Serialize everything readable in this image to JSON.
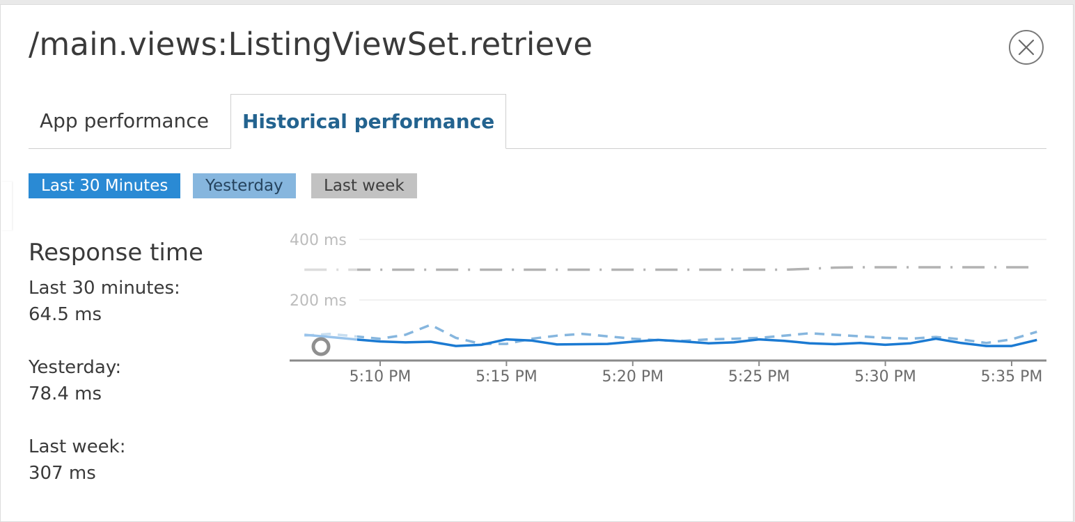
{
  "header": {
    "title": "/main.views:ListingViewSet.retrieve",
    "close_icon": "close-icon"
  },
  "tabs": [
    {
      "label": "App performance",
      "active": false
    },
    {
      "label": "Historical performance",
      "active": true
    }
  ],
  "range_buttons": [
    {
      "label": "Last 30 Minutes",
      "color": "#2a8ad4"
    },
    {
      "label": "Yesterday",
      "color": "#86b6de"
    },
    {
      "label": "Last week",
      "color": "#c2c2c2"
    }
  ],
  "summary": {
    "title": "Response time",
    "last30_label": "Last 30 minutes:",
    "last30_value": "64.5 ms",
    "yesterday_label": "Yesterday:",
    "yesterday_value": "78.4 ms",
    "lastweek_label": "Last week:",
    "lastweek_value": "307 ms"
  },
  "chart_data": {
    "type": "line",
    "title": "",
    "xlabel": "",
    "ylabel": "",
    "ylim": [
      0,
      400
    ],
    "y_ticks": [
      {
        "value": 200,
        "label": "200 ms"
      },
      {
        "value": 400,
        "label": "400 ms"
      }
    ],
    "x_ticks": [
      "5:10 PM",
      "5:15 PM",
      "5:20 PM",
      "5:25 PM",
      "5:30 PM",
      "5:35 PM"
    ],
    "x_tick_minutes": [
      10,
      15,
      20,
      25,
      30,
      35
    ],
    "x_range_minutes": [
      7,
      36
    ],
    "grid": true,
    "series": [
      {
        "key": "last_30_minutes",
        "color": "#1b7ad2",
        "style": "solid",
        "x": [
          7,
          8,
          9,
          10,
          11,
          12,
          13,
          14,
          15,
          16,
          17,
          18,
          19,
          20,
          21,
          22,
          23,
          24,
          25,
          26,
          27,
          28,
          29,
          30,
          31,
          32,
          33,
          34,
          35,
          36
        ],
        "values": [
          85,
          78,
          70,
          63,
          60,
          62,
          48,
          52,
          70,
          66,
          53,
          54,
          55,
          62,
          68,
          63,
          57,
          60,
          70,
          65,
          57,
          54,
          58,
          52,
          57,
          72,
          58,
          48,
          48,
          68
        ]
      },
      {
        "key": "yesterday",
        "color": "#86b6de",
        "style": "dash",
        "x": [
          7,
          8,
          9,
          10,
          11,
          12,
          13,
          14,
          15,
          16,
          17,
          18,
          19,
          20,
          21,
          22,
          23,
          24,
          25,
          26,
          27,
          28,
          29,
          30,
          31,
          32,
          33,
          34,
          35,
          36
        ],
        "values": [
          82,
          88,
          80,
          72,
          85,
          118,
          75,
          55,
          55,
          72,
          82,
          88,
          80,
          72,
          67,
          65,
          70,
          72,
          75,
          82,
          90,
          85,
          80,
          75,
          72,
          78,
          70,
          58,
          70,
          95
        ]
      },
      {
        "key": "last_week",
        "color": "#b2b2b2",
        "style": "dash-dot",
        "x": [
          7,
          8,
          9,
          10,
          11,
          12,
          13,
          14,
          15,
          16,
          17,
          18,
          19,
          20,
          21,
          22,
          23,
          24,
          25,
          26,
          27,
          28,
          29,
          30,
          31,
          32,
          33,
          34,
          35,
          36
        ],
        "values": [
          300,
          300,
          300,
          300,
          300,
          300,
          300,
          300,
          300,
          300,
          300,
          300,
          300,
          300,
          300,
          300,
          300,
          300,
          300,
          300,
          303,
          307,
          308,
          308,
          308,
          308,
          308,
          308,
          308,
          308
        ]
      }
    ]
  }
}
